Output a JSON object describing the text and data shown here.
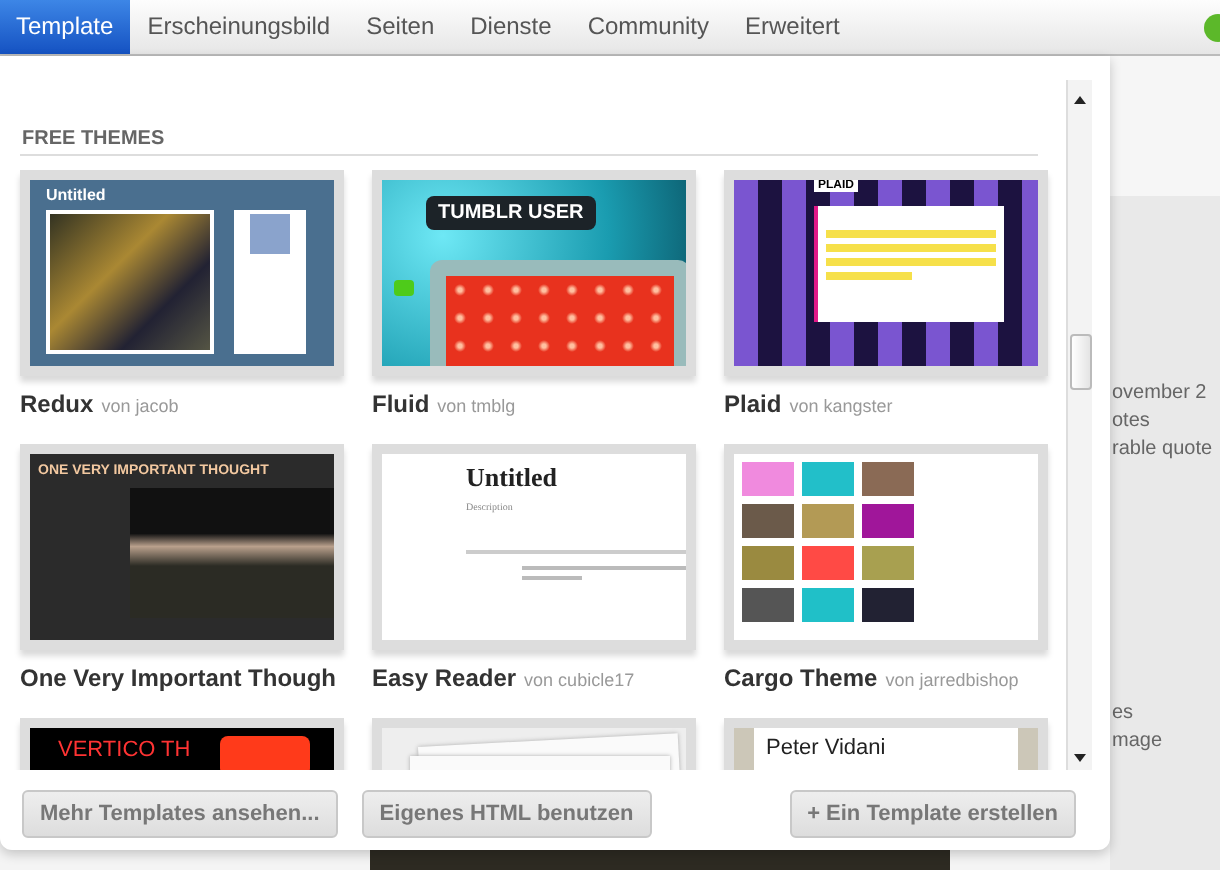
{
  "tabs": [
    {
      "label": "Template",
      "selected": true
    },
    {
      "label": "Erscheinungsbild",
      "selected": false
    },
    {
      "label": "Seiten",
      "selected": false
    },
    {
      "label": "Dienste",
      "selected": false
    },
    {
      "label": "Community",
      "selected": false
    },
    {
      "label": "Erweitert",
      "selected": false
    }
  ],
  "section_title": "FREE THEMES",
  "themes": [
    {
      "name": "Redux",
      "author": "von jacob",
      "preview": {
        "kind": "redux",
        "heading": "Untitled"
      }
    },
    {
      "name": "Fluid",
      "author": "von tmblg",
      "preview": {
        "kind": "fluid",
        "heading": "TUMBLR USER"
      }
    },
    {
      "name": "Plaid",
      "author": "von kangster",
      "preview": {
        "kind": "plaid",
        "heading": "PLAID"
      }
    },
    {
      "name": "One Very Important Though",
      "preview": {
        "kind": "dark",
        "heading": "ONE VERY IMPORTANT THOUGHT"
      }
    },
    {
      "name": "Easy Reader",
      "author": "von cubicle17",
      "preview": {
        "kind": "reader",
        "heading": "Untitled",
        "subheading": "Description"
      }
    },
    {
      "name": "Cargo Theme",
      "author": "von jarredbishop",
      "preview": {
        "kind": "cargo"
      }
    },
    {
      "preview": {
        "kind": "vertico",
        "heading": "VERTICO TH"
      }
    },
    {
      "preview": {
        "kind": "paper"
      }
    },
    {
      "preview": {
        "kind": "vidani",
        "heading": "Peter Vidani"
      }
    }
  ],
  "buttons": [
    {
      "label": "Mehr Templates ansehen..."
    },
    {
      "label": "Eigenes HTML benutzen"
    },
    {
      "label": "+ Ein Template erstellen"
    }
  ],
  "background": {
    "texts": [
      "ovember 2",
      "otes",
      "rable quote"
    ],
    "bottom_texts": [
      "es",
      "mage"
    ]
  }
}
